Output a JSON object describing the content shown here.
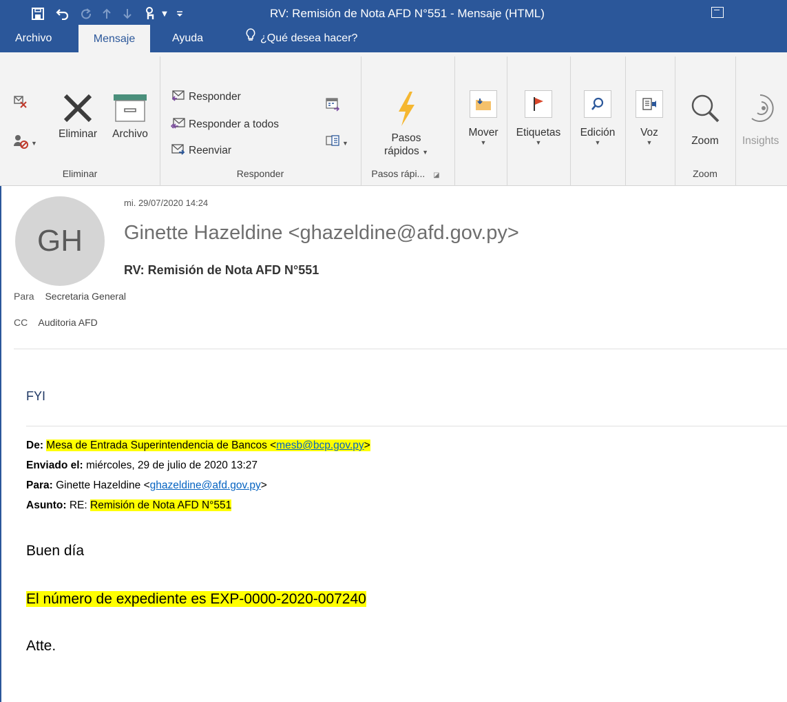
{
  "window": {
    "title": "RV: Remisión de Nota AFD N°551  -  Mensaje (HTML)"
  },
  "tabs": [
    {
      "label": "Archivo"
    },
    {
      "label": "Mensaje"
    },
    {
      "label": "Ayuda"
    },
    {
      "label": "¿Qué desea hacer?"
    }
  ],
  "ribbon": {
    "eliminar_group": {
      "label": "Eliminar",
      "delete": "Eliminar",
      "archive": "Archivo"
    },
    "responder_group": {
      "label": "Responder",
      "reply": "Responder",
      "reply_all": "Responder a todos",
      "forward": "Reenviar"
    },
    "pasos_group": {
      "label": "Pasos rápi...",
      "button_line1": "Pasos",
      "button_line2": "rápidos"
    },
    "mover": "Mover",
    "etiquetas": "Etiquetas",
    "edicion": "Edición",
    "voz": "Voz",
    "zoom_group": {
      "label": "Zoom",
      "button": "Zoom"
    },
    "insights": "Insights"
  },
  "message": {
    "avatar_initials": "GH",
    "date": "mi. 29/07/2020 14:24",
    "sender": "Ginette Hazeldine <ghazeldine@afd.gov.py>",
    "subject": "RV: Remisión de Nota AFD N°551",
    "to_label": "Para",
    "to_value": "Secretaria General",
    "cc_label": "CC",
    "cc_value": "Auditoria AFD"
  },
  "body": {
    "fyi": "FYI",
    "from_label": "De:",
    "from_name": "Mesa de Entrada Superintendencia de Bancos <",
    "from_email": "mesb@bcp.gov.py",
    "from_close": ">",
    "sent_label": "Enviado el:",
    "sent_value": " miércoles, 29 de julio de 2020 13:27",
    "to_label": "Para:",
    "to_name": " Ginette Hazeldine <",
    "to_email": "ghazeldine@afd.gov.py",
    "to_close": ">",
    "subject_label": "Asunto:",
    "subject_prefix": " RE: ",
    "subject_value": "Remisión de Nota AFD N°551",
    "greeting": "Buen día",
    "expediente": "El número de expediente es EXP-0000-2020-007240",
    "signoff": "Atte."
  },
  "colors": {
    "titlebar": "#2b579a",
    "ribbon": "#f3f3f3",
    "highlight": "#ffff00",
    "link": "#0563c1"
  }
}
